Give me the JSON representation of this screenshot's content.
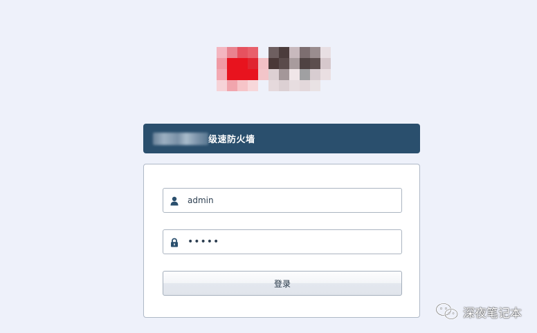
{
  "header": {
    "title": "级速防火墙"
  },
  "login": {
    "username_value": "admin",
    "password_value": "•••••",
    "submit_label": "登录"
  },
  "watermark": {
    "text": "深夜笔记本",
    "icon": "wechat-icon"
  },
  "icons": {
    "user": "user-icon",
    "lock": "lock-icon"
  },
  "colors": {
    "background": "#eef1fa",
    "header": "#2a4f6d",
    "logo_red": "#e8131e"
  }
}
